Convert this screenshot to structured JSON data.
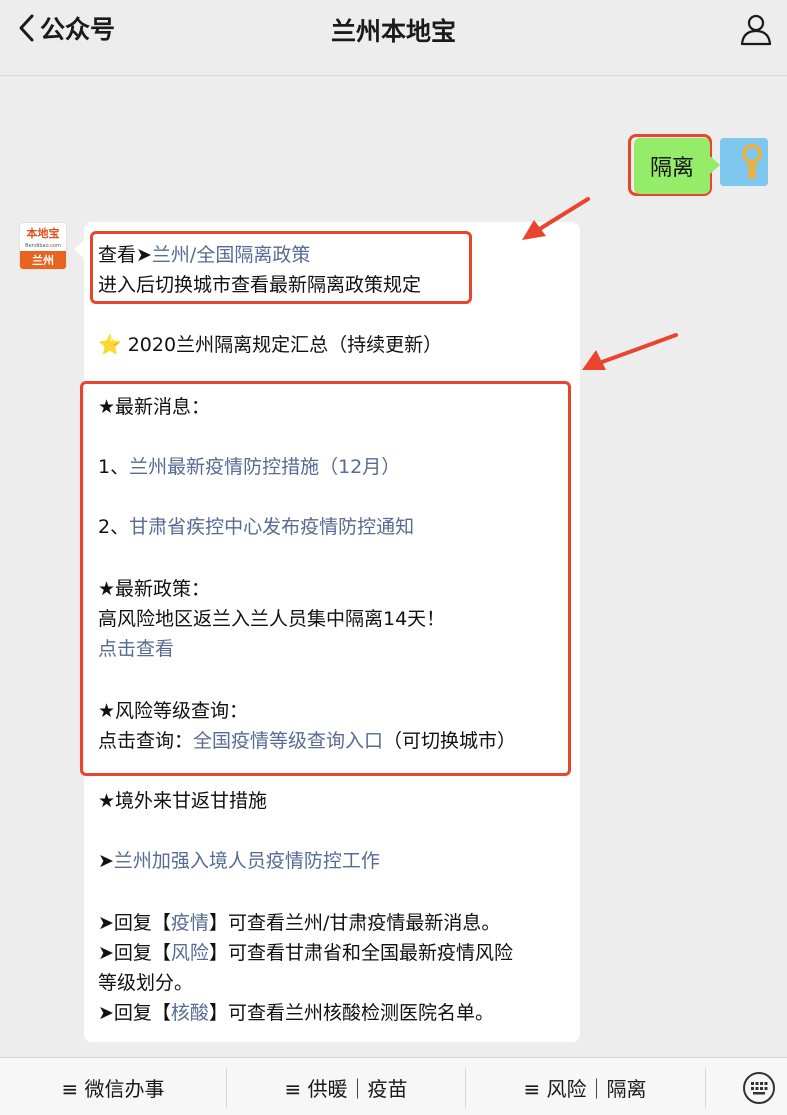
{
  "header": {
    "back_label": "公众号",
    "title": "兰州本地宝"
  },
  "user_message": {
    "text": "隔离"
  },
  "oa_avatar": {
    "logo_text": "本地宝",
    "logo_sub": "Bendibao.com",
    "city_label": "兰州"
  },
  "reply": {
    "line1_prefix": "查看➤",
    "line1_link": "兰州/全国隔离政策",
    "line2": "进入后切换城市查看最新隔离政策规定",
    "summary_star": "⭐",
    "summary": "2020兰州隔离规定汇总（持续更新）",
    "latest_news_heading": "★最新消息：",
    "news1_prefix": "1、",
    "news1_link": "兰州最新疫情防控措施（12月）",
    "news2_prefix": "2、",
    "news2_link": "甘肃省疾控中心发布疫情防控通知",
    "policy_heading": "★最新政策：",
    "policy_text": "高风险地区返兰入兰人员集中隔离14天！",
    "policy_link": "点击查看",
    "risk_heading": "★风险等级查询：",
    "risk_prefix": "点击查询：",
    "risk_link": "全国疫情等级查询入口",
    "risk_suffix": "（可切换城市）",
    "overseas_heading": "★境外来甘返甘措施",
    "overseas_prefix": "➤",
    "overseas_link": "兰州加强入境人员疫情防控工作",
    "reply1_a": "➤回复【",
    "reply1_kw": "疫情",
    "reply1_b": "】可查看兰州/甘肃疫情最新消息。",
    "reply2_a": "➤回复【",
    "reply2_kw": "风险",
    "reply2_b": "】可查看甘肃省和全国最新疫情风险",
    "reply2_c": "等级划分。",
    "reply3_a": "➤回复【",
    "reply3_kw": "核酸",
    "reply3_b": "】可查看兰州核酸检测医院名单。"
  },
  "bottom_menu": {
    "items": [
      {
        "label": "≡ 微信办事"
      },
      {
        "label": "≡ 供暖｜疫苗"
      },
      {
        "label": "≡ 风险｜隔离"
      }
    ]
  },
  "colors": {
    "link": "#576b95",
    "highlight_box": "#e8452c",
    "user_bubble": "#95ec69"
  }
}
